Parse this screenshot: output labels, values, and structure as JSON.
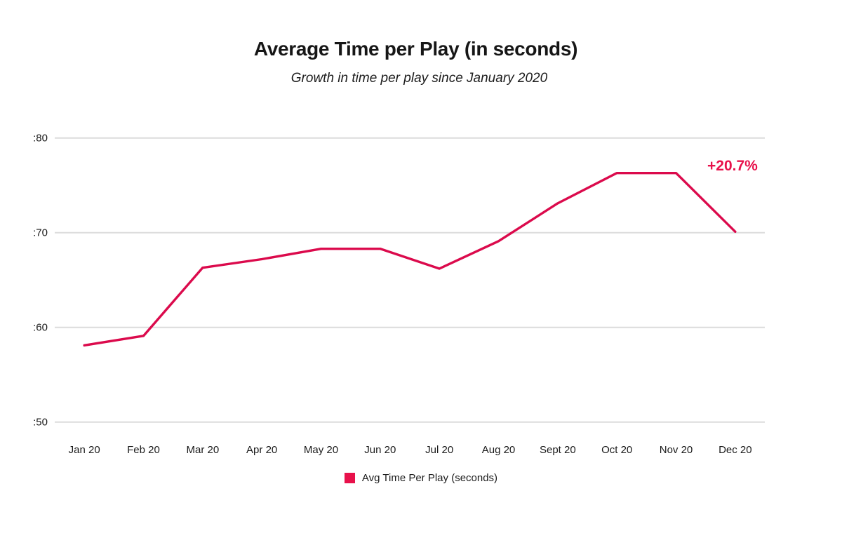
{
  "chart_data": {
    "type": "line",
    "title": "Average Time per Play (in seconds)",
    "subtitle": "Growth in time per play since January 2020",
    "xlabel": "",
    "ylabel": "",
    "categories": [
      "Jan 20",
      "Feb 20",
      "Mar 20",
      "Apr 20",
      "May 20",
      "Jun 20",
      "Jul 20",
      "Aug 20",
      "Sept 20",
      "Oct 20",
      "Nov 20",
      "Dec 20"
    ],
    "series": [
      {
        "name": "Avg Time Per Play (seconds)",
        "color": "#DB0A4C",
        "values": [
          58.1,
          59.1,
          66.3,
          67.2,
          68.3,
          68.3,
          66.2,
          69.1,
          73.1,
          76.3,
          76.3,
          70.1
        ]
      }
    ],
    "ylim": [
      50,
      80
    ],
    "ytick_labels": [
      ":80",
      ":70",
      ":60",
      ":50"
    ],
    "ytick_values": [
      80,
      70,
      60,
      50
    ],
    "grid": true,
    "gridline_color": "#DCDCDC",
    "legend_position": "bottom",
    "annotations": [
      {
        "text": "+20.7%",
        "color": "#E8114B",
        "anchor": "end-of-line"
      }
    ]
  },
  "legend": {
    "items": [
      {
        "label": "Avg Time Per Play (seconds)",
        "color": "#E8114B"
      }
    ]
  }
}
